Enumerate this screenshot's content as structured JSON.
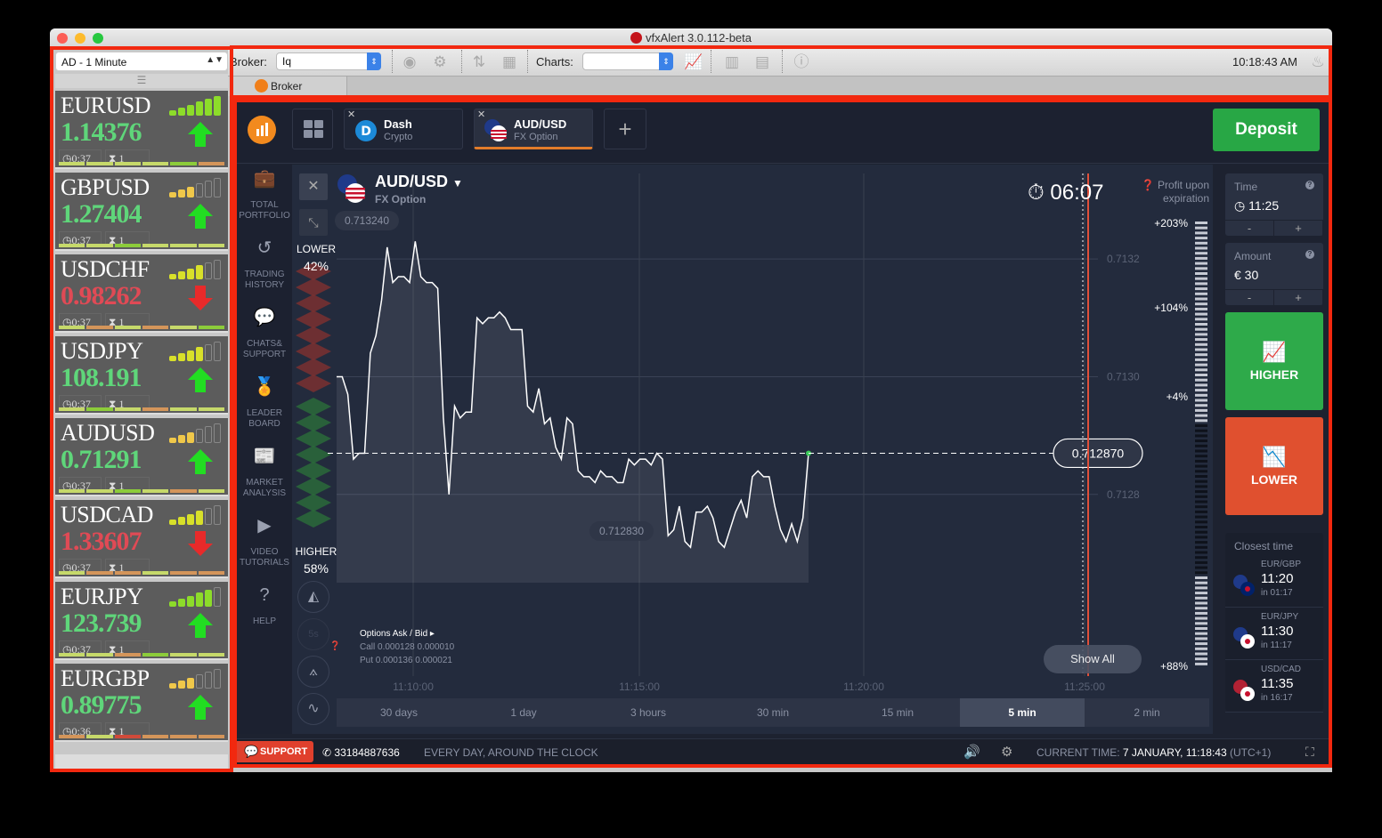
{
  "window": {
    "title": "vfxAlert 3.0.112-beta"
  },
  "toolbar": {
    "broker_label": "Broker:",
    "broker_value": "Iq",
    "charts_label": "Charts:",
    "charts_value": "",
    "clock": "10:18:43 AM",
    "icons": [
      "chrome-icon",
      "gear-icon",
      "swap-arrows-icon",
      "calendar-icon",
      "chart-trend-icon",
      "layout-columns-icon",
      "layout-rows-icon",
      "info-icon",
      "flame-icon"
    ]
  },
  "tabstrip": {
    "broker_tab": "Broker"
  },
  "sidebar": {
    "interval_select": "AD - 1 Minute",
    "pairs": [
      {
        "name": "EURUSD",
        "price": "1.14376",
        "direction": "up",
        "timer": "0:37",
        "count": "1",
        "signal": 6,
        "signal_color": "#8ddc2a",
        "bars": [
          "#c6d96a",
          "#c6d96a",
          "#c6d96a",
          "#c6d96a",
          "#8ccc3a",
          "#d4955a"
        ]
      },
      {
        "name": "GBPUSD",
        "price": "1.27404",
        "direction": "up",
        "timer": "0:37",
        "count": "1",
        "signal": 3,
        "signal_color": "#f0c84a",
        "bars": [
          "#c6d96a",
          "#c6d96a",
          "#8ccc3a",
          "#c6d96a",
          "#c6d96a",
          "#c6d96a"
        ]
      },
      {
        "name": "USDCHF",
        "price": "0.98262",
        "direction": "down",
        "timer": "0:37",
        "count": "1",
        "signal": 4,
        "signal_color": "#d8e02a",
        "bars": [
          "#c6d96a",
          "#d4955a",
          "#c6d96a",
          "#d4955a",
          "#c6d96a",
          "#8ccc3a"
        ]
      },
      {
        "name": "USDJPY",
        "price": "108.191",
        "direction": "up",
        "timer": "0:37",
        "count": "1",
        "signal": 4,
        "signal_color": "#d8e02a",
        "bars": [
          "#c6d96a",
          "#8ccc3a",
          "#c6d96a",
          "#d4955a",
          "#c6d96a",
          "#c6d96a"
        ]
      },
      {
        "name": "AUDUSD",
        "price": "0.71291",
        "direction": "up",
        "timer": "0:37",
        "count": "1",
        "signal": 3,
        "signal_color": "#f0c84a",
        "bars": [
          "#c6d96a",
          "#c6d96a",
          "#8ccc3a",
          "#c6d96a",
          "#d4955a",
          "#c6d96a"
        ]
      },
      {
        "name": "USDCAD",
        "price": "1.33607",
        "direction": "down",
        "timer": "0:37",
        "count": "1",
        "signal": 4,
        "signal_color": "#d8e02a",
        "bars": [
          "#c6d96a",
          "#d4955a",
          "#d4955a",
          "#c6d96a",
          "#d4955a",
          "#d4955a"
        ]
      },
      {
        "name": "EURJPY",
        "price": "123.739",
        "direction": "up",
        "timer": "0:37",
        "count": "1",
        "signal": 5,
        "signal_color": "#8ddc2a",
        "bars": [
          "#c6d96a",
          "#c6d96a",
          "#d4955a",
          "#8ccc3a",
          "#c6d96a",
          "#c6d96a"
        ]
      },
      {
        "name": "EURGBP",
        "price": "0.89775",
        "direction": "up",
        "timer": "0:36",
        "count": "1",
        "signal": 3,
        "signal_color": "#f0c84a",
        "bars": [
          "#d4955a",
          "#c6d96a",
          "#d04a3a",
          "#d4955a",
          "#d4955a",
          "#d4955a"
        ]
      }
    ]
  },
  "colors": {
    "up": "#5fd67a",
    "down": "#e04a55",
    "accent": "#f28a1e",
    "higher": "#2eaa4a",
    "lower": "#e0502f",
    "deposit": "#28a745"
  },
  "topnav": {
    "tabs": [
      {
        "name": "Dash",
        "sub": "Crypto"
      },
      {
        "name": "AUD/USD",
        "sub": "FX Option",
        "active": true
      }
    ],
    "deposit": "Deposit"
  },
  "leftnav": [
    {
      "label": "TOTAL PORTFOLIO",
      "icon": "briefcase-icon"
    },
    {
      "label": "TRADING HISTORY",
      "icon": "history-icon"
    },
    {
      "label": "CHATS& SUPPORT",
      "icon": "chat-icon"
    },
    {
      "label": "LEADER BOARD",
      "icon": "medal-icon"
    },
    {
      "label": "MARKET ANALYSIS",
      "icon": "newspaper-icon"
    },
    {
      "label": "VIDEO TUTORIALS",
      "icon": "play-icon"
    },
    {
      "label": "HELP",
      "icon": "help-icon"
    }
  ],
  "chart": {
    "asset": "AUD/USD",
    "asset_type": "FX Option",
    "countdown": "06:07",
    "profit_label": "Profit upon expiration",
    "lower_label": "LOWER",
    "lower_pct": "42%",
    "higher_label": "HIGHER",
    "higher_pct": "58%",
    "max_label": "0.713240",
    "min_label": "0.712830",
    "current": "0.712870",
    "yticks": [
      "0.7132",
      "0.7130",
      "0.7128"
    ],
    "xticks": [
      "11:10:00",
      "11:15:00",
      "11:20:00",
      "11:25:00"
    ],
    "profit_scale": [
      "+203%",
      "+104%",
      "+4%",
      "+88%"
    ],
    "show_all": "Show All",
    "options_title": "Options Ask / Bid",
    "call_label": "Call",
    "call_values": "0.000128  0.000010",
    "put_label": "Put",
    "put_values": "0.000136  0.000021",
    "timeframes": [
      "30 days",
      "1 day",
      "3 hours",
      "30 min",
      "15 min",
      "5 min",
      "2 min"
    ],
    "selected_timeframe": "5 min",
    "series": [
      0.713,
      0.713,
      0.71297,
      0.71286,
      0.71287,
      0.71287,
      0.71304,
      0.71307,
      0.71313,
      0.71322,
      0.71316,
      0.71317,
      0.71317,
      0.71316,
      0.71323,
      0.71317,
      0.71316,
      0.71316,
      0.71315,
      0.71293,
      0.7128,
      0.71295,
      0.71293,
      0.71294,
      0.71294,
      0.7131,
      0.71309,
      0.7131,
      0.7131,
      0.71311,
      0.7131,
      0.71308,
      0.71308,
      0.71308,
      0.71295,
      0.71294,
      0.71298,
      0.71292,
      0.71293,
      0.71288,
      0.71286,
      0.71293,
      0.71292,
      0.71284,
      0.71283,
      0.71283,
      0.71282,
      0.71284,
      0.71283,
      0.71283,
      0.71282,
      0.71282,
      0.71286,
      0.71285,
      0.71286,
      0.71286,
      0.71285,
      0.71287,
      0.71286,
      0.71273,
      0.71274,
      0.71278,
      0.71272,
      0.71271,
      0.71277,
      0.71277,
      0.71278,
      0.71276,
      0.71272,
      0.71271,
      0.71274,
      0.71277,
      0.71279,
      0.71276,
      0.71283,
      0.71284,
      0.71283,
      0.71283,
      0.71278,
      0.71274,
      0.71272,
      0.71275,
      0.71272,
      0.71276,
      0.71287
    ]
  },
  "rightpanel": {
    "time_label": "Time",
    "time_value": "11:25",
    "amount_label": "Amount",
    "amount_value": "€  30",
    "higher": "HIGHER",
    "lower": "LOWER",
    "closest_title": "Closest time",
    "closest": [
      {
        "pair": "EUR/GBP",
        "time": "11:20",
        "in": "in 01:17"
      },
      {
        "pair": "EUR/JPY",
        "time": "11:30",
        "in": "in 11:17"
      },
      {
        "pair": "USD/CAD",
        "time": "11:35",
        "in": "in 16:17"
      }
    ]
  },
  "footer": {
    "support": "SUPPORT",
    "phone": "33184887636",
    "hours": "EVERY DAY, AROUND THE CLOCK",
    "current_time_label": "CURRENT TIME:",
    "current_time": "7 JANUARY, 11:18:43",
    "tz": "(UTC+1)"
  }
}
